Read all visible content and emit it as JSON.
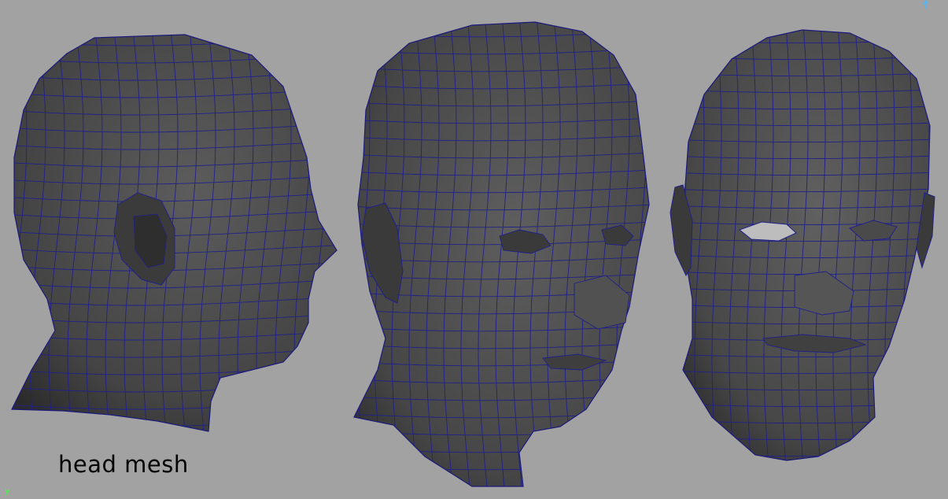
{
  "viewport": {
    "background": "#a2a2a2",
    "mesh_fill": "#474747",
    "wire_color": "#1a1a8c"
  },
  "caption": "head mesh",
  "axis": {
    "y_label": "y"
  },
  "meshes": [
    {
      "view": "side"
    },
    {
      "view": "three-quarter"
    },
    {
      "view": "front"
    }
  ]
}
